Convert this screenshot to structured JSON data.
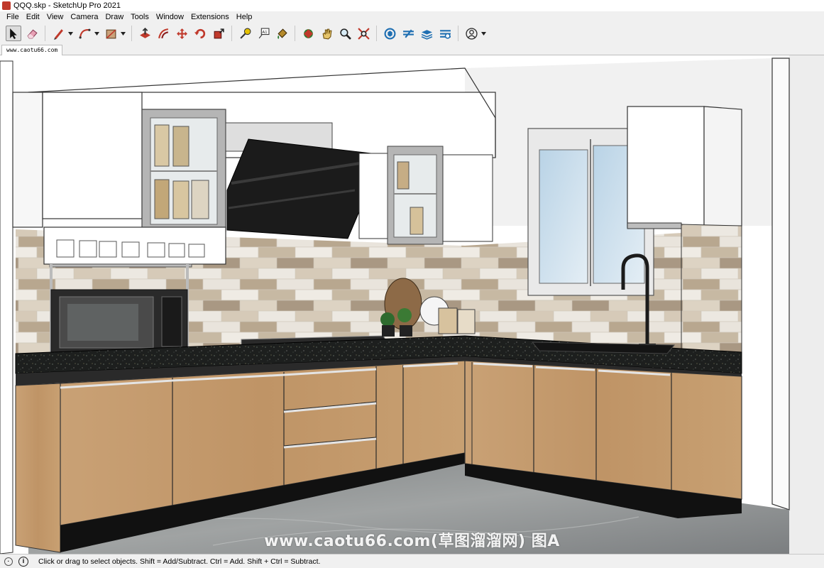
{
  "window": {
    "title": "QQQ.skp - SketchUp Pro 2021"
  },
  "menu": [
    "File",
    "Edit",
    "View",
    "Camera",
    "Draw",
    "Tools",
    "Window",
    "Extensions",
    "Help"
  ],
  "toolbar": {
    "tools": [
      {
        "name": "select-tool",
        "icon": "arrow-cursor-icon",
        "active": true
      },
      {
        "name": "eraser-tool",
        "icon": "eraser-icon"
      },
      {
        "name": "line-tool",
        "icon": "pencil-icon",
        "dropdown": true
      },
      {
        "name": "arc-tool",
        "icon": "arc-icon",
        "dropdown": true
      },
      {
        "name": "rectangle-tool",
        "icon": "rectangle-icon",
        "dropdown": true
      },
      {
        "name": "push-pull-tool",
        "icon": "push-pull-icon"
      },
      {
        "name": "offset-tool",
        "icon": "offset-icon"
      },
      {
        "name": "move-tool",
        "icon": "move-arrows-icon"
      },
      {
        "name": "rotate-tool",
        "icon": "rotate-icon"
      },
      {
        "name": "scale-tool",
        "icon": "scale-icon"
      },
      {
        "name": "tape-measure-tool",
        "icon": "tape-measure-icon"
      },
      {
        "name": "text-tool",
        "icon": "text-label-icon"
      },
      {
        "name": "paint-bucket-tool",
        "icon": "paint-bucket-icon"
      },
      {
        "name": "orbit-tool",
        "icon": "orbit-icon"
      },
      {
        "name": "pan-tool",
        "icon": "hand-icon"
      },
      {
        "name": "zoom-tool",
        "icon": "magnifier-icon"
      },
      {
        "name": "zoom-extents-tool",
        "icon": "zoom-extents-icon"
      },
      {
        "name": "3d-warehouse",
        "icon": "warehouse-icon"
      },
      {
        "name": "extension-warehouse",
        "icon": "extension-warehouse-icon"
      },
      {
        "name": "layout",
        "icon": "layers-stack-icon"
      },
      {
        "name": "extension-manager",
        "icon": "extension-manager-icon"
      },
      {
        "name": "account",
        "icon": "user-account-icon",
        "dropdown": true
      }
    ],
    "text_tool_label": "A1"
  },
  "scene_tab": "www.caotu66.com",
  "viewport": {
    "watermark": "www.caotu66.com(草图溜溜网) 图A",
    "colors": {
      "wood": "#c39b6c",
      "countertop": "#1c1c1c",
      "cabinet_white": "#ffffff",
      "tile_light": "#ece7df",
      "tile_mid": "#cdbfa9",
      "tile_dark": "#a89780",
      "floor": "#8e9192",
      "hood": "#1a1a1a",
      "glass": "#c9dbe8"
    }
  },
  "status": {
    "text": "Click or drag to select objects. Shift = Add/Subtract. Ctrl = Add. Shift + Ctrl = Subtract."
  }
}
